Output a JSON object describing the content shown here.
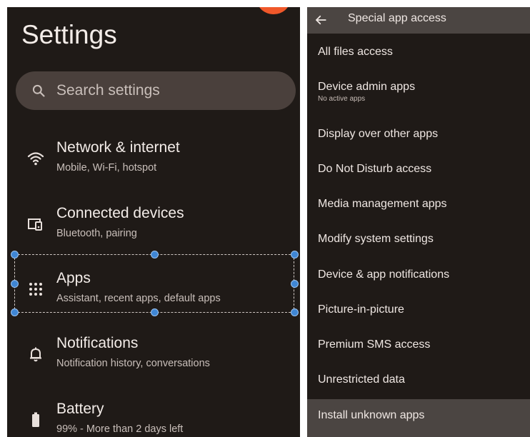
{
  "settings": {
    "title": "Settings",
    "search_placeholder": "Search settings",
    "items": [
      {
        "title": "Network & internet",
        "subtitle": "Mobile, Wi-Fi, hotspot",
        "icon": "wifi-icon"
      },
      {
        "title": "Connected devices",
        "subtitle": "Bluetooth, pairing",
        "icon": "devices-icon"
      },
      {
        "title": "Apps",
        "subtitle": "Assistant, recent apps, default apps",
        "icon": "apps-grid-icon"
      },
      {
        "title": "Notifications",
        "subtitle": "Notification history, conversations",
        "icon": "bell-icon"
      },
      {
        "title": "Battery",
        "subtitle": "99% - More than 2 days left",
        "icon": "battery-icon"
      }
    ]
  },
  "special_access": {
    "title": "Special app access",
    "items": [
      {
        "label": "All files access"
      },
      {
        "label": "Device admin apps",
        "sub": "No active apps"
      },
      {
        "label": "Display over other apps"
      },
      {
        "label": "Do Not Disturb access"
      },
      {
        "label": "Media management apps"
      },
      {
        "label": "Modify system settings"
      },
      {
        "label": "Device & app notifications"
      },
      {
        "label": "Picture-in-picture"
      },
      {
        "label": "Premium SMS access"
      },
      {
        "label": "Unrestricted data"
      },
      {
        "label": "Install unknown apps"
      }
    ]
  },
  "colors": {
    "background": "#1f1a17",
    "accent_avatar": "#f0582a",
    "selection_handle": "#3f86d4",
    "highlight_row": "#4b4542"
  }
}
